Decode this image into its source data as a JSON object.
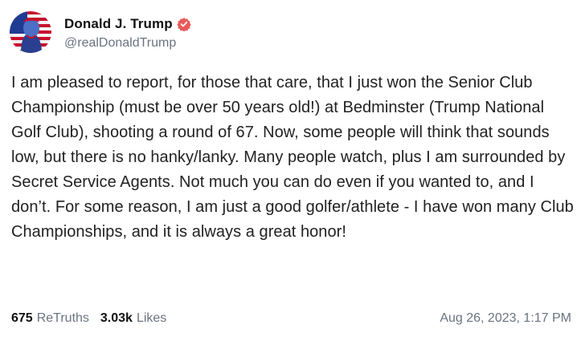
{
  "post": {
    "author": {
      "display_name": "Donald J. Trump",
      "handle": "@realDonaldTrump",
      "verified": true,
      "verified_badge_color": "#e85a5a",
      "avatar_icon": "avatar-flag-portrait"
    },
    "text": "I am pleased to report, for those that care, that I just won the Senior Club Championship (must be over 50 years old!) at Bedminster (Trump National Golf Club), shooting a round of 67. Now, some people will think that sounds low, but there is no hanky/lanky. Many people watch,  plus I am surrounded by Secret Service Agents. Not much you can do even if you wanted to, and I don’t. For some reason, I am just a good golfer/athlete - I have won many Club Championships, and it is always a great honor!",
    "stats": {
      "retruths_count": "675",
      "retruths_label": "ReTruths",
      "likes_count": "3.03k",
      "likes_label": "Likes"
    },
    "timestamp": "Aug 26, 2023, 1:17 PM"
  }
}
